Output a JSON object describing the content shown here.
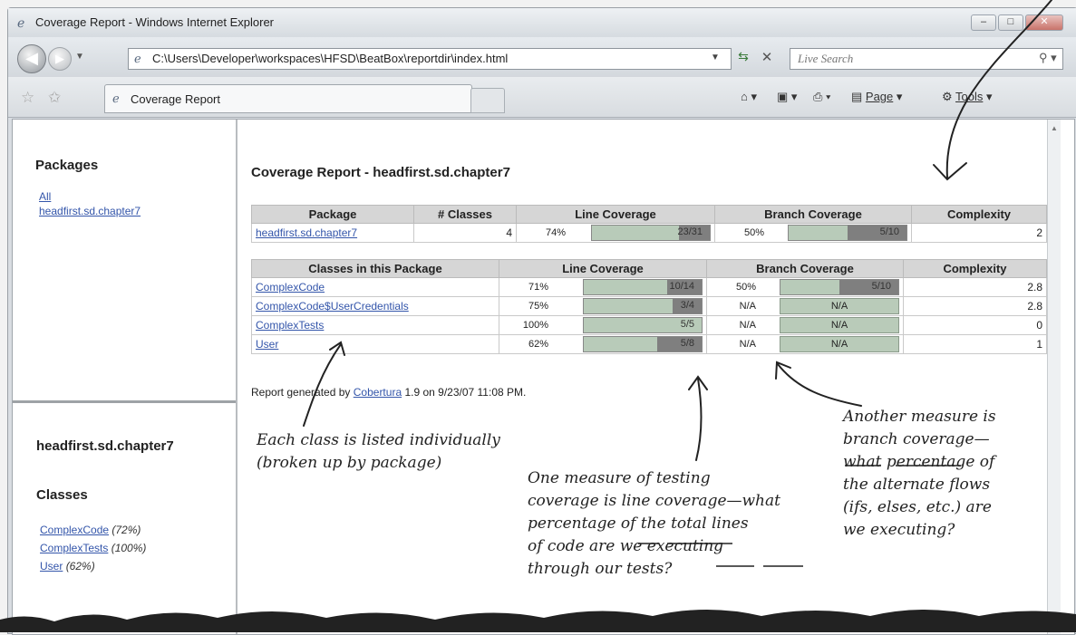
{
  "window": {
    "title": "Coverage Report - Windows Internet Explorer",
    "buttons": [
      "–",
      "□",
      "✕"
    ]
  },
  "addressbar": {
    "url": "C:\\Users\\Developer\\workspaces\\HFSD\\BeatBox\\reportdir\\index.html",
    "search_placeholder": "Live Search"
  },
  "tabs": {
    "active_label": "Coverage Report",
    "tools": {
      "page": "Page",
      "tools": "Tools"
    }
  },
  "left": {
    "packages_heading": "Packages",
    "packages": [
      "All",
      "headfirst.sd.chapter7"
    ],
    "package_heading": "headfirst.sd.chapter7",
    "classes_heading": "Classes",
    "classes": [
      {
        "name": "ComplexCode",
        "pct": "(72%)"
      },
      {
        "name": "ComplexTests",
        "pct": "(100%)"
      },
      {
        "name": "User",
        "pct": "(62%)"
      }
    ]
  },
  "report": {
    "title": "Coverage Report - headfirst.sd.chapter7",
    "package_table": {
      "headers": [
        "Package",
        "# Classes",
        "Line Coverage",
        "Branch Coverage",
        "Complexity"
      ],
      "row": {
        "package": "headfirst.sd.chapter7",
        "classes": "4",
        "line_pct": "74%",
        "line_ratio": "23/31",
        "line_fraction": 0.74,
        "branch_pct": "50%",
        "branch_ratio": "5/10",
        "branch_fraction": 0.5,
        "complexity": "2"
      }
    },
    "class_table": {
      "headers": [
        "Classes in this Package",
        "Line Coverage",
        "Branch Coverage",
        "Complexity"
      ],
      "rows": [
        {
          "name": "ComplexCode",
          "line_pct": "71%",
          "line_ratio": "10/14",
          "line_fraction": 0.71,
          "branch_pct": "50%",
          "branch_ratio": "5/10",
          "branch_fraction": 0.5,
          "complexity": "2.8"
        },
        {
          "name": "ComplexCode$UserCredentials",
          "line_pct": "75%",
          "line_ratio": "3/4",
          "line_fraction": 0.75,
          "branch_pct": "N/A",
          "branch_ratio": "N/A",
          "complexity": "2.8"
        },
        {
          "name": "ComplexTests",
          "line_pct": "100%",
          "line_ratio": "5/5",
          "line_fraction": 1.0,
          "branch_pct": "N/A",
          "branch_ratio": "N/A",
          "complexity": "0"
        },
        {
          "name": "User",
          "line_pct": "62%",
          "line_ratio": "5/8",
          "line_fraction": 0.62,
          "branch_pct": "N/A",
          "branch_ratio": "N/A",
          "complexity": "1"
        }
      ]
    },
    "footer": {
      "prefix": "Report generated by ",
      "link": "Cobertura",
      "suffix": " 1.9 on 9/23/07 11:08 PM."
    }
  },
  "annotations": {
    "classes_note": [
      "Each class is listed individually",
      "(broken up by package)"
    ],
    "line_note": [
      "One measure of testing",
      "coverage is line coverage—what",
      "percentage of the total lines",
      "of code are we executing",
      "through our tests?"
    ],
    "branch_note": [
      "Another measure is",
      "branch coverage—",
      "what percentage of",
      "the alternate flows",
      "(ifs, elses, etc.) are",
      "we executing?"
    ]
  }
}
